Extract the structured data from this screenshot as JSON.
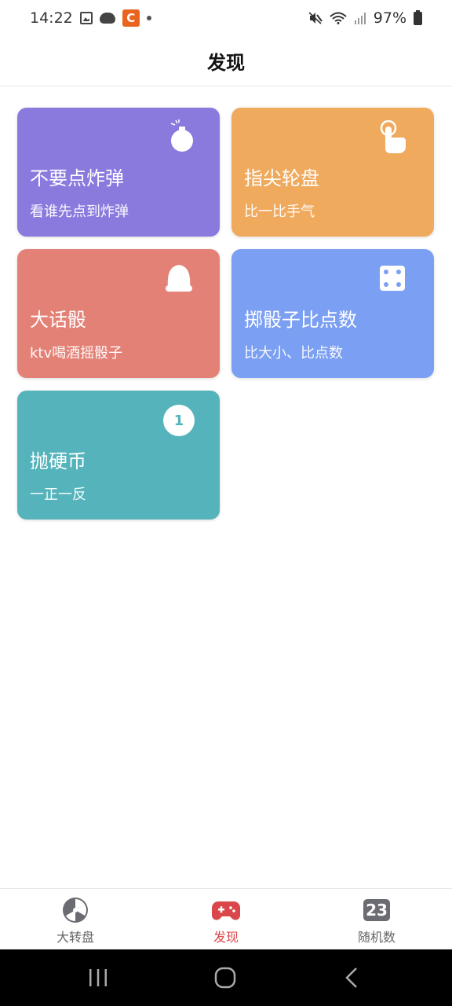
{
  "status_bar": {
    "time": "14:22",
    "app_badge": "C",
    "battery": "97%"
  },
  "header": {
    "title": "发现"
  },
  "cards": [
    {
      "title": "不要点炸弹",
      "subtitle": "看谁先点到炸弹",
      "color": "#8a7ade",
      "icon": "bomb-icon"
    },
    {
      "title": "指尖轮盘",
      "subtitle": "比一比手气",
      "color": "#f0aa5e",
      "icon": "tap-finger-icon"
    },
    {
      "title": "大话骰",
      "subtitle": "ktv喝酒摇骰子",
      "color": "#e48176",
      "icon": "dice-cup-icon"
    },
    {
      "title": "掷骰子比点数",
      "subtitle": "比大小、比点数",
      "color": "#7b9ff2",
      "icon": "dice-icon"
    },
    {
      "title": "抛硬币",
      "subtitle": "一正一反",
      "color": "#55b3bb",
      "icon": "coin-icon",
      "icon_text": "1"
    }
  ],
  "bottom_nav": [
    {
      "label": "大转盘",
      "icon": "wheel-icon",
      "active": false,
      "color": "#6b6b72"
    },
    {
      "label": "发现",
      "icon": "gamepad-icon",
      "active": true,
      "color": "#d9474a"
    },
    {
      "label": "随机数",
      "icon": "random-number-icon",
      "icon_text": "23",
      "active": false,
      "color": "#6b6b72"
    }
  ]
}
